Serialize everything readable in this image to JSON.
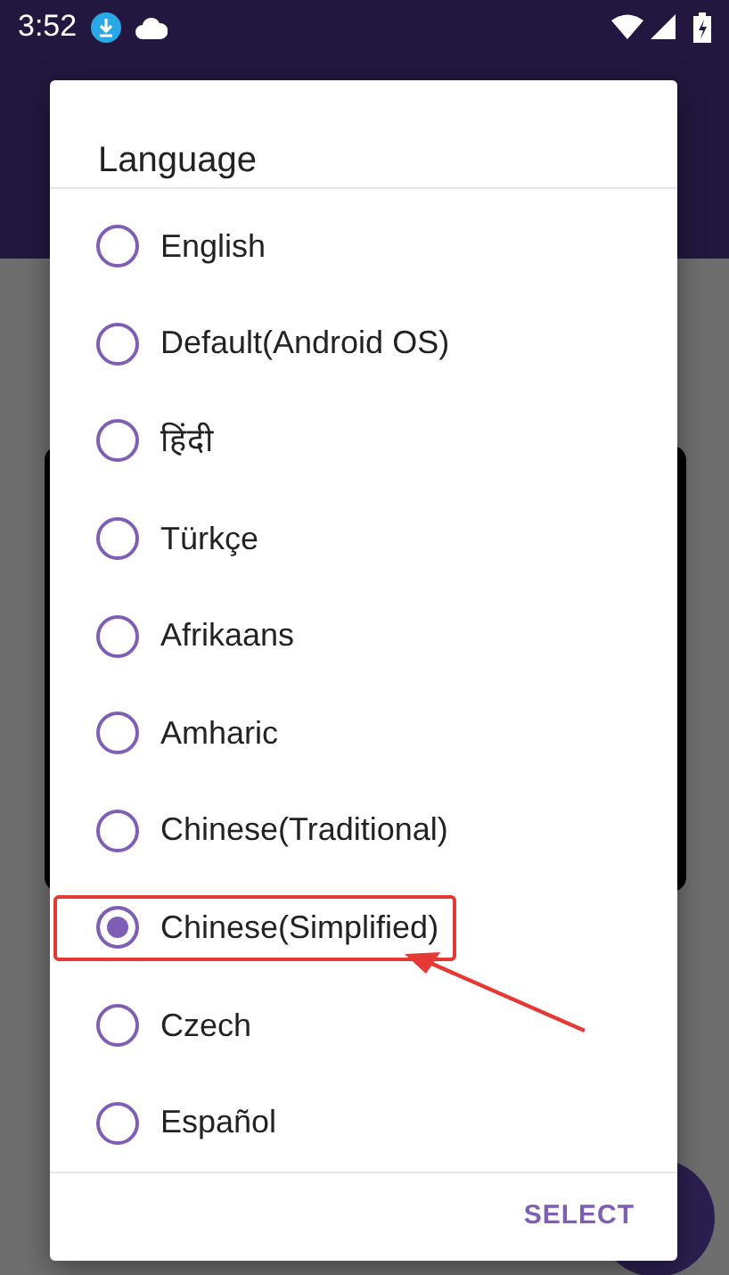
{
  "status_bar": {
    "time": "3:52"
  },
  "dialog": {
    "title": "Language",
    "options": [
      {
        "label": "English",
        "selected": false,
        "highlighted": false
      },
      {
        "label": "Default(Android OS)",
        "selected": false,
        "highlighted": false
      },
      {
        "label": "हिंदी",
        "selected": false,
        "highlighted": false
      },
      {
        "label": "Türkçe",
        "selected": false,
        "highlighted": false
      },
      {
        "label": "Afrikaans",
        "selected": false,
        "highlighted": false
      },
      {
        "label": "Amharic",
        "selected": false,
        "highlighted": false
      },
      {
        "label": "Chinese(Traditional)",
        "selected": false,
        "highlighted": false
      },
      {
        "label": "Chinese(Simplified)",
        "selected": true,
        "highlighted": true
      },
      {
        "label": "Czech",
        "selected": false,
        "highlighted": false
      },
      {
        "label": "Español",
        "selected": false,
        "highlighted": false
      }
    ],
    "button": "SELECT"
  }
}
